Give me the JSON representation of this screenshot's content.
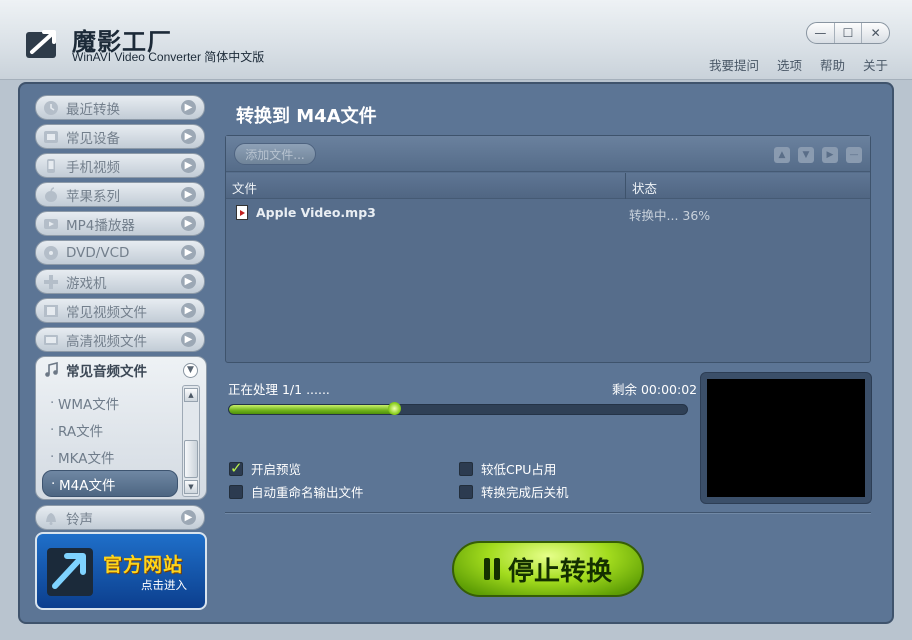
{
  "app": {
    "title": "魔影工厂",
    "subtitle": "WinAVI Video Converter 简体中文版",
    "window_buttons": [
      "—",
      "☐",
      "✕"
    ],
    "top_menu": [
      "我要提问",
      "选项",
      "帮助",
      "关于"
    ]
  },
  "sidebar": {
    "items": [
      {
        "label": "最近转换",
        "icon": "clock-icon"
      },
      {
        "label": "常见设备",
        "icon": "device-icon"
      },
      {
        "label": "手机视频",
        "icon": "phone-icon"
      },
      {
        "label": "苹果系列",
        "icon": "apple-icon"
      },
      {
        "label": "MP4播放器",
        "icon": "mp4-player-icon"
      },
      {
        "label": "DVD/VCD",
        "icon": "disc-icon"
      },
      {
        "label": "游戏机",
        "icon": "gamepad-icon"
      },
      {
        "label": "常见视频文件",
        "icon": "film-icon"
      },
      {
        "label": "高清视频文件",
        "icon": "hd-icon"
      }
    ],
    "audio_group": {
      "label": "常见音频文件",
      "icon": "music-note-icon",
      "sub_items": [
        "WMA文件",
        "RA文件",
        "MKA文件",
        "M4A文件"
      ],
      "active_index": 3
    },
    "bottom_item": {
      "label": "铃声",
      "icon": "bell-icon"
    },
    "promo": {
      "title": "官方网站",
      "subtitle": "点击进入"
    }
  },
  "main": {
    "title": "转换到 M4A文件",
    "add_button": "添加文件...",
    "columns": [
      "文件",
      "状态"
    ],
    "files": [
      {
        "name": "Apple Video.mp3",
        "status": "转换中... 36%"
      }
    ],
    "processing_label": "正在处理 1/1 ......",
    "remaining_label": "剩余 00:00:02",
    "progress_fraction": 0.36,
    "options": {
      "preview": {
        "label": "开启预览",
        "checked": true
      },
      "low_cpu": {
        "label": "较低CPU占用",
        "checked": false
      },
      "auto_rename": {
        "label": "自动重命名输出文件",
        "checked": false
      },
      "shutdown": {
        "label": "转换完成后关机",
        "checked": false
      }
    },
    "stop_button": "停止转换"
  },
  "colors": {
    "frame": "#5c7595",
    "accent_green": "#8ccf20",
    "title_text": "#ffffff"
  }
}
